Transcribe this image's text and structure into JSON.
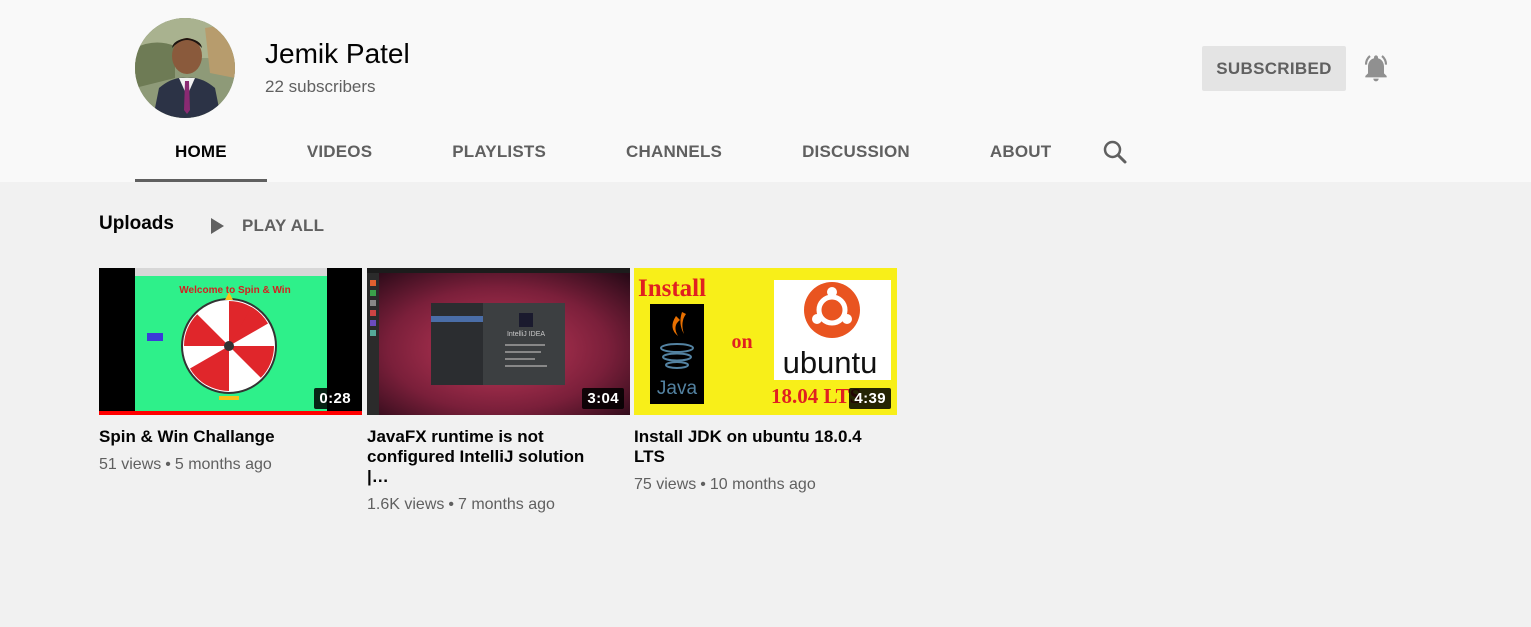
{
  "channel": {
    "name": "Jemik Patel",
    "subscribers": "22 subscribers",
    "subscribe_label": "SUBSCRIBED"
  },
  "tabs": [
    {
      "label": "HOME",
      "active": true
    },
    {
      "label": "VIDEOS"
    },
    {
      "label": "PLAYLISTS"
    },
    {
      "label": "CHANNELS"
    },
    {
      "label": "DISCUSSION"
    },
    {
      "label": "ABOUT"
    }
  ],
  "icons": {
    "bell": "notification-bell-icon",
    "search": "search-icon",
    "play": "play-icon"
  },
  "uploads": {
    "title": "Uploads",
    "play_all": "PLAY ALL",
    "videos": [
      {
        "title": "Spin & Win Challange",
        "views": "51 views",
        "age": "5 months ago",
        "duration": "0:28",
        "watched_fraction": 1.0,
        "thumb_text": "Welcome to Spin & Win"
      },
      {
        "title": "JavaFX runtime is not configured IntelliJ solution |…",
        "views": "1.6K views",
        "age": "7 months ago",
        "duration": "3:04",
        "thumb_text": "IntelliJ IDEA"
      },
      {
        "title": "Install JDK on ubuntu 18.0.4 LTS",
        "views": "75 views",
        "age": "10 months ago",
        "duration": "4:39",
        "thumb_install": "Install",
        "thumb_on": "on",
        "thumb_java": "Java",
        "thumb_ubuntu": "ubuntu",
        "thumb_version": "18.04 LTS"
      }
    ]
  },
  "colors": {
    "accent_red": "#ff0000",
    "header_bg": "#f9f9f9",
    "page_bg": "#f1f1f1",
    "secondary_text": "#606060"
  }
}
